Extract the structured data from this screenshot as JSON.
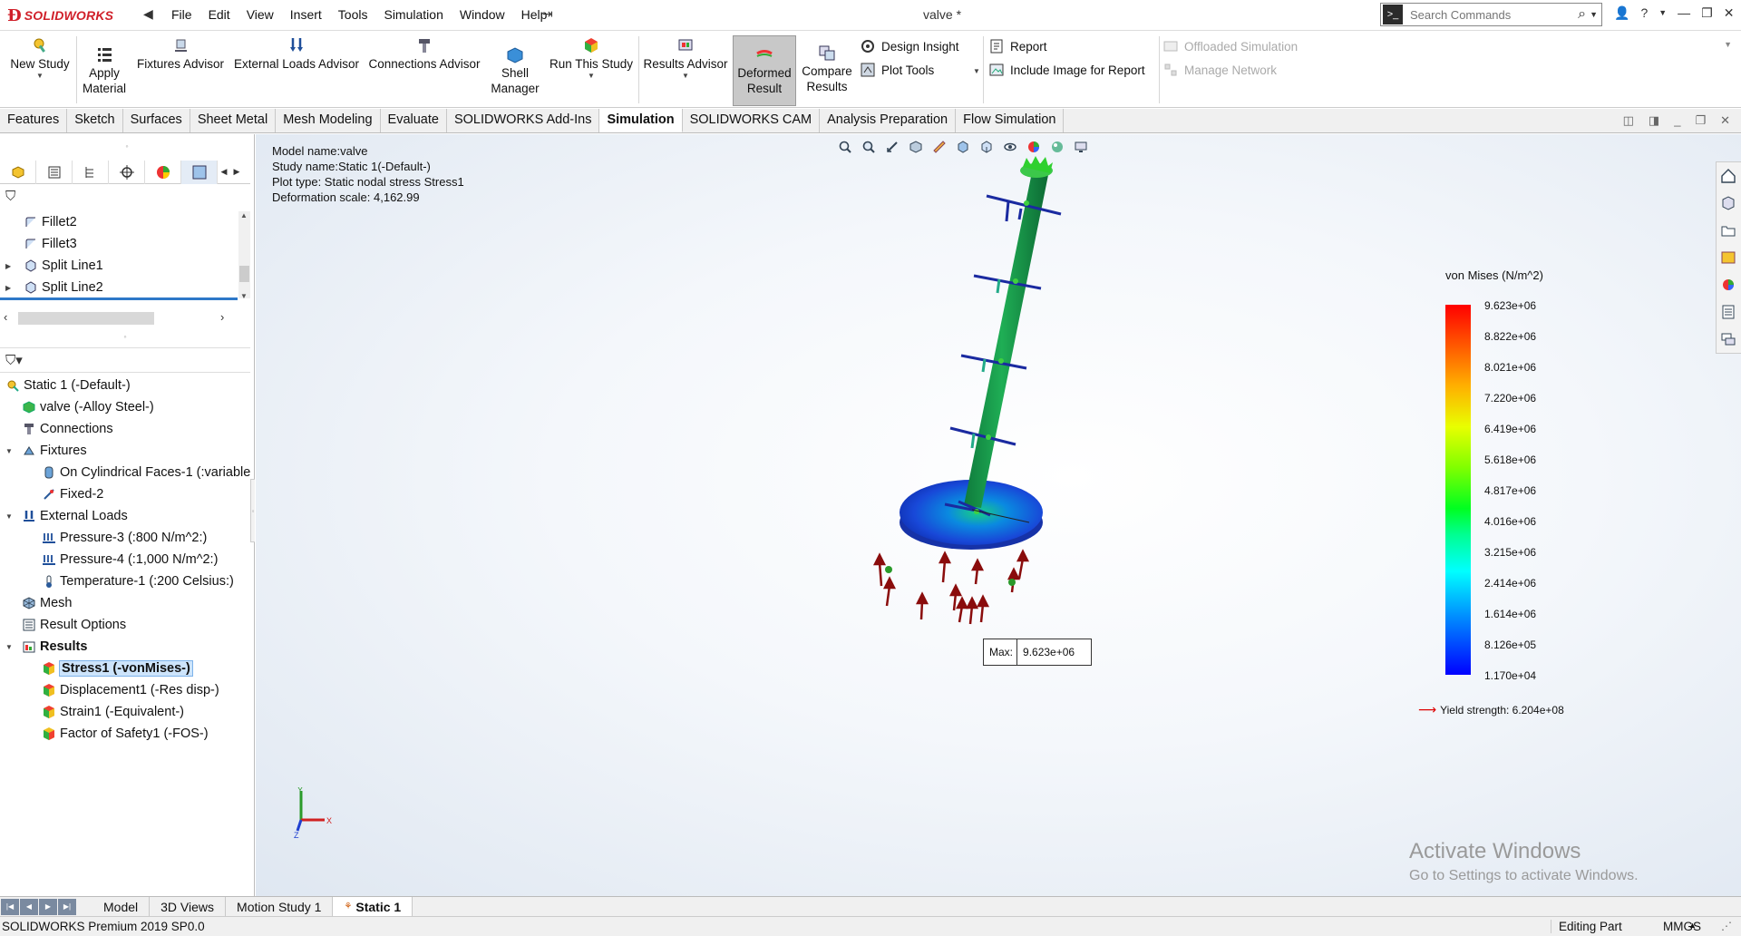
{
  "app": {
    "logo_text": "SOLIDWORKS",
    "document_title": "valve *",
    "menus": [
      "File",
      "Edit",
      "View",
      "Insert",
      "Tools",
      "Simulation",
      "Window",
      "Help"
    ],
    "search_placeholder": "Search Commands"
  },
  "ribbon": {
    "new_study": "New Study",
    "apply_material": [
      "Apply",
      "Material"
    ],
    "fixtures_advisor": "Fixtures Advisor",
    "external_loads_advisor": "External Loads Advisor",
    "connections_advisor": "Connections Advisor",
    "shell_manager": [
      "Shell",
      "Manager"
    ],
    "run_this_study": "Run This Study",
    "results_advisor": "Results Advisor",
    "deformed_result": [
      "Deformed",
      "Result"
    ],
    "compare_results": [
      "Compare",
      "Results"
    ],
    "design_insight": "Design Insight",
    "plot_tools": "Plot Tools",
    "report": "Report",
    "include_image": "Include Image for Report",
    "offloaded_simulation": "Offloaded Simulation",
    "manage_network": "Manage Network"
  },
  "tabs": [
    "Features",
    "Sketch",
    "Surfaces",
    "Sheet Metal",
    "Mesh Modeling",
    "Evaluate",
    "SOLIDWORKS Add-Ins",
    "Simulation",
    "SOLIDWORKS CAM",
    "Analysis Preparation",
    "Flow Simulation"
  ],
  "active_tab": "Simulation",
  "feature_tree": [
    "Fillet2",
    "Fillet3",
    "Split Line1",
    "Split Line2"
  ],
  "sim_tree": [
    {
      "label": "Static 1 (-Default-)",
      "indent": 0,
      "icon": "study-icon"
    },
    {
      "label": "valve (-Alloy Steel-)",
      "indent": 1,
      "icon": "part-icon"
    },
    {
      "label": "Connections",
      "indent": 1,
      "icon": "connections-icon"
    },
    {
      "label": "Fixtures",
      "indent": 1,
      "icon": "fixtures-icon",
      "expand": true
    },
    {
      "label": "On Cylindrical Faces-1 (:variable",
      "indent": 2,
      "icon": "cylindrical-fixture-icon"
    },
    {
      "label": "Fixed-2",
      "indent": 2,
      "icon": "fixed-icon"
    },
    {
      "label": "External Loads",
      "indent": 1,
      "icon": "external-loads-icon",
      "expand": true
    },
    {
      "label": "Pressure-3 (:800 N/m^2:)",
      "indent": 2,
      "icon": "pressure-icon"
    },
    {
      "label": "Pressure-4 (:1,000 N/m^2:)",
      "indent": 2,
      "icon": "pressure-icon"
    },
    {
      "label": "Temperature-1 (:200 Celsius:)",
      "indent": 2,
      "icon": "temperature-icon"
    },
    {
      "label": "Mesh",
      "indent": 1,
      "icon": "mesh-icon"
    },
    {
      "label": "Result Options",
      "indent": 1,
      "icon": "result-options-icon"
    },
    {
      "label": "Results",
      "indent": 1,
      "icon": "results-folder-icon",
      "expand": true,
      "bold": true
    },
    {
      "label": "Stress1 (-vonMises-)",
      "indent": 2,
      "icon": "stress-plot-icon",
      "selected": true
    },
    {
      "label": "Displacement1 (-Res disp-)",
      "indent": 2,
      "icon": "displacement-plot-icon"
    },
    {
      "label": "Strain1 (-Equivalent-)",
      "indent": 2,
      "icon": "strain-plot-icon"
    },
    {
      "label": "Factor of Safety1 (-FOS-)",
      "indent": 2,
      "icon": "fos-plot-icon"
    }
  ],
  "plot_info": {
    "model": "Model name:valve",
    "study": "Study name:Static 1(-Default-)",
    "plot_type": "Plot type: Static nodal stress Stress1",
    "deformation": "Deformation scale: 4,162.99"
  },
  "legend": {
    "title": "von Mises (N/m^2)",
    "ticks": [
      "9.623e+06",
      "8.822e+06",
      "8.021e+06",
      "7.220e+06",
      "6.419e+06",
      "5.618e+06",
      "4.817e+06",
      "4.016e+06",
      "3.215e+06",
      "2.414e+06",
      "1.614e+06",
      "8.126e+05",
      "1.170e+04"
    ],
    "yield": "Yield strength: 6.204e+08",
    "colors": {
      "max": "#ff0000",
      "min": "#0000ff",
      "yield_arrow": "#dd0000"
    }
  },
  "max_label": {
    "key": "Max:",
    "value": "9.623e+06"
  },
  "activate": {
    "heading": "Activate Windows",
    "sub": "Go to Settings to activate Windows."
  },
  "bottom_tabs": [
    "Model",
    "3D Views",
    "Motion Study 1",
    "Static 1"
  ],
  "active_bottom_tab": "Static 1",
  "status": {
    "product": "SOLIDWORKS Premium 2019 SP0.0",
    "mode": "Editing Part",
    "units": "MMGS"
  }
}
